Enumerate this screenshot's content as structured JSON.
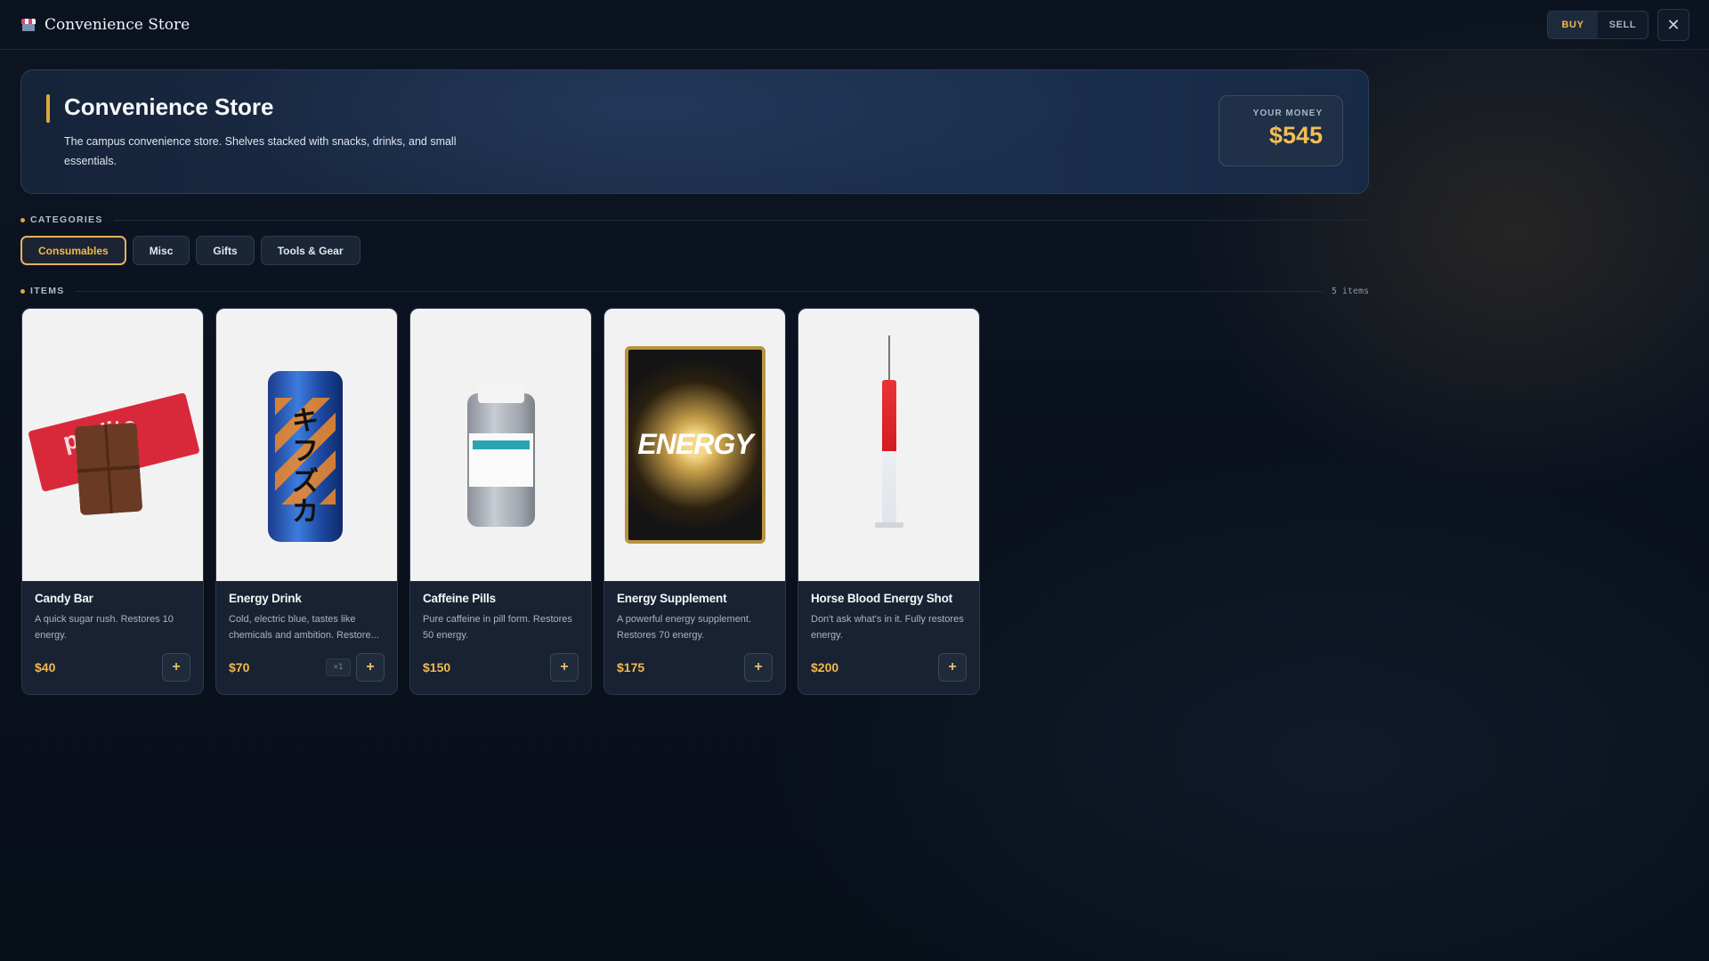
{
  "topbar": {
    "title": "Convenience Store",
    "buy_label": "BUY",
    "sell_label": "SELL",
    "active_mode": "BUY"
  },
  "hero": {
    "title": "Convenience Store",
    "description": "The campus convenience store. Shelves stacked with snacks, drinks, and small essentials.",
    "money_label": "YOUR MONEY",
    "money_value": "$545"
  },
  "categories": {
    "label": "CATEGORIES",
    "items": [
      "Consumables",
      "Misc",
      "Gifts",
      "Tools & Gear"
    ],
    "active": "Consumables"
  },
  "items_section": {
    "label": "ITEMS",
    "count": "5 items"
  },
  "items": [
    {
      "name": "Candy Bar",
      "description": "A quick sugar rush. Restores 10 energy.",
      "price": "$40",
      "image": "candy-bar-image",
      "wrapper_text": "pralite"
    },
    {
      "name": "Energy Drink",
      "description": "Cold, electric blue, tastes like chemicals and ambition. Restore...",
      "price": "$70",
      "image": "energy-drink-image",
      "qty": "×1",
      "can_text": "キフズカ"
    },
    {
      "name": "Caffeine Pills",
      "description": "Pure caffeine in pill form. Restores 50 energy.",
      "price": "$150",
      "image": "caffeine-pills-image"
    },
    {
      "name": "Energy Supplement",
      "description": "A powerful energy supplement. Restores 70 energy.",
      "price": "$175",
      "image": "energy-supplement-image",
      "pouch_text": "ENERGY"
    },
    {
      "name": "Horse Blood Energy Shot",
      "description": "Don't ask what's in it. Fully restores energy.",
      "price": "$200",
      "image": "syringe-image"
    }
  ],
  "colors": {
    "accent": "#f0b94d",
    "background": "#0b1320",
    "card": "#182232"
  }
}
